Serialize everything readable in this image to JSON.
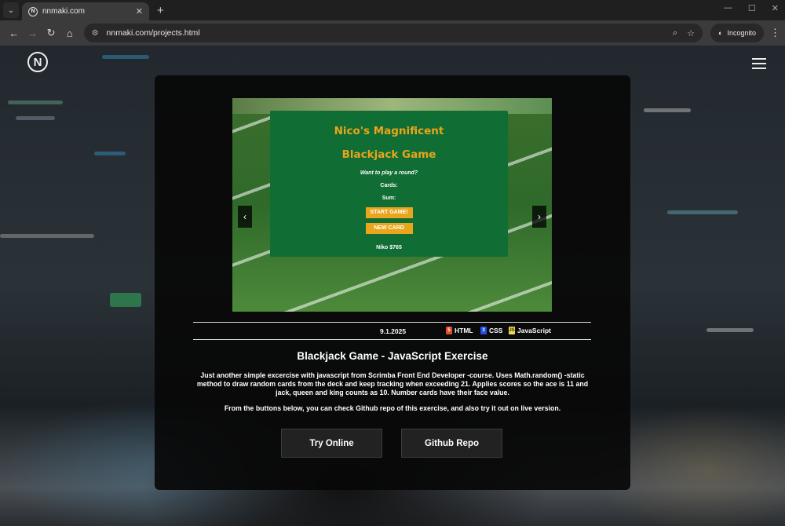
{
  "browser": {
    "tab_title": "nnmaki.com",
    "new_tab": "+",
    "url": "nnmaki.com/projects.html",
    "mode_label": "Incognito"
  },
  "site": {
    "logo_letter": "N"
  },
  "game": {
    "title_line1": "Nico's Magnificent",
    "title_line2": "Blackjack Game",
    "message": "Want to play a round?",
    "cards_label": "Cards:",
    "sum_label": "Sum:",
    "start_button": "START GAME!",
    "new_card_button": "NEW CARD",
    "player": "Niko $765"
  },
  "project": {
    "date": "9.1.2025",
    "tags": [
      {
        "label": "HTML",
        "icon": "html5-icon",
        "color": "#e44d26"
      },
      {
        "label": "CSS",
        "icon": "css3-icon",
        "color": "#264de4"
      },
      {
        "label": "JavaScript",
        "icon": "javascript-icon",
        "color": "#f0db4f"
      }
    ],
    "title": "Blackjack Game - JavaScript Exercise",
    "description": "Just another simple excercise with javascript from Scrimba Front End Developer -course. Uses Math.random() -static method to draw random cards from the deck and keep tracking when exceeding 21. Applies scores so the ace is 11 and jack, queen and king counts as 10. Number cards have their face value.",
    "note": "From the buttons below, you can check Github repo of this exercise, and also try it out on live version.",
    "try_button": "Try Online",
    "github_button": "Github Repo"
  }
}
